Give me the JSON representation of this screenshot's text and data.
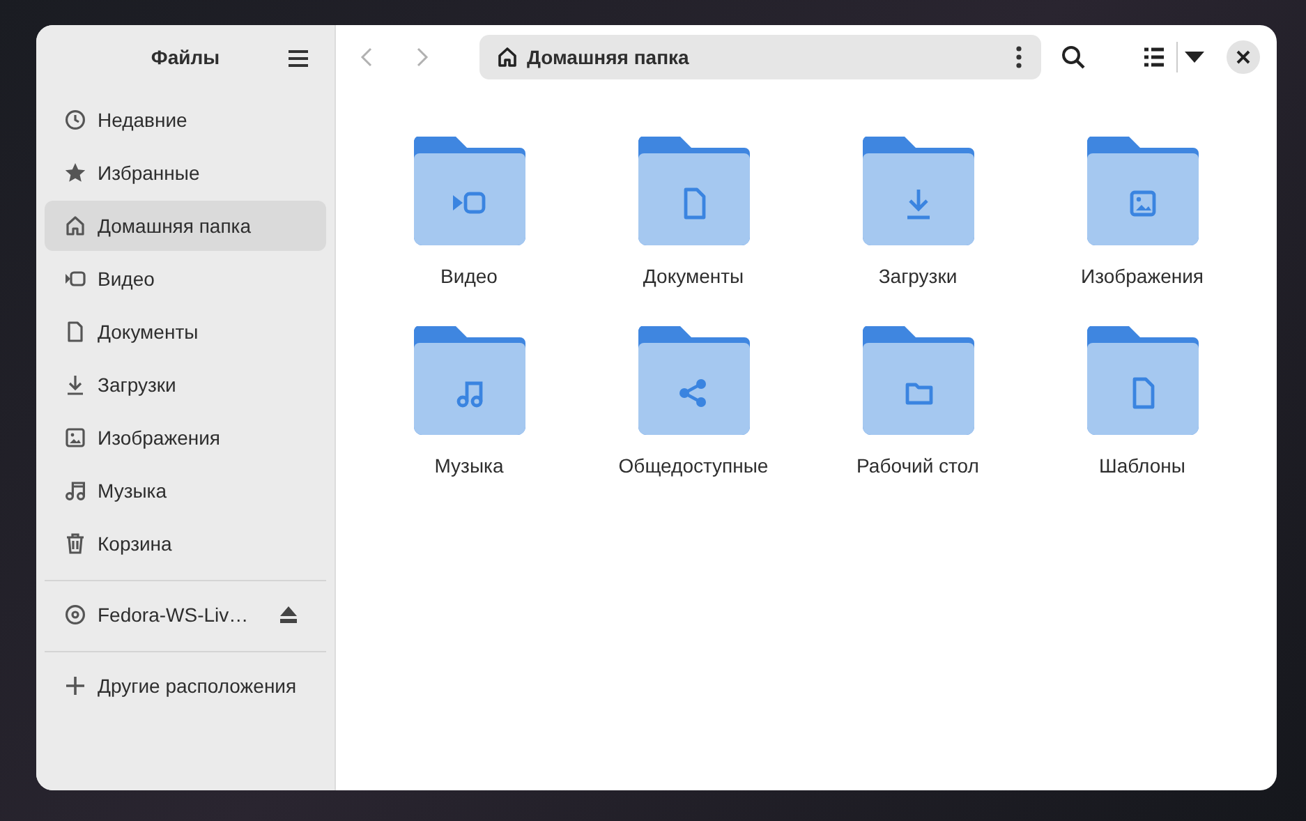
{
  "window": {
    "title": "Файлы"
  },
  "sidebar": {
    "places": [
      {
        "label": "Недавние",
        "selected": false
      },
      {
        "label": "Избранные",
        "selected": false
      },
      {
        "label": "Домашняя папка",
        "selected": true
      },
      {
        "label": "Видео",
        "selected": false
      },
      {
        "label": "Документы",
        "selected": false
      },
      {
        "label": "Загрузки",
        "selected": false
      },
      {
        "label": "Изображения",
        "selected": false
      },
      {
        "label": "Музыка",
        "selected": false
      },
      {
        "label": "Корзина",
        "selected": false
      }
    ],
    "devices": [
      {
        "label": "Fedora-WS-Liv…"
      }
    ],
    "other_locations": {
      "label": "Другие расположения"
    }
  },
  "toolbar": {
    "back": {
      "disabled": true
    },
    "forward": {
      "disabled": true
    },
    "path": "Домашняя папка"
  },
  "folders": [
    {
      "name": "Видео"
    },
    {
      "name": "Документы"
    },
    {
      "name": "Загрузки"
    },
    {
      "name": "Изображения"
    },
    {
      "name": "Музыка"
    },
    {
      "name": "Общедоступные"
    },
    {
      "name": "Рабочий стол"
    },
    {
      "name": "Шаблоны"
    }
  ]
}
